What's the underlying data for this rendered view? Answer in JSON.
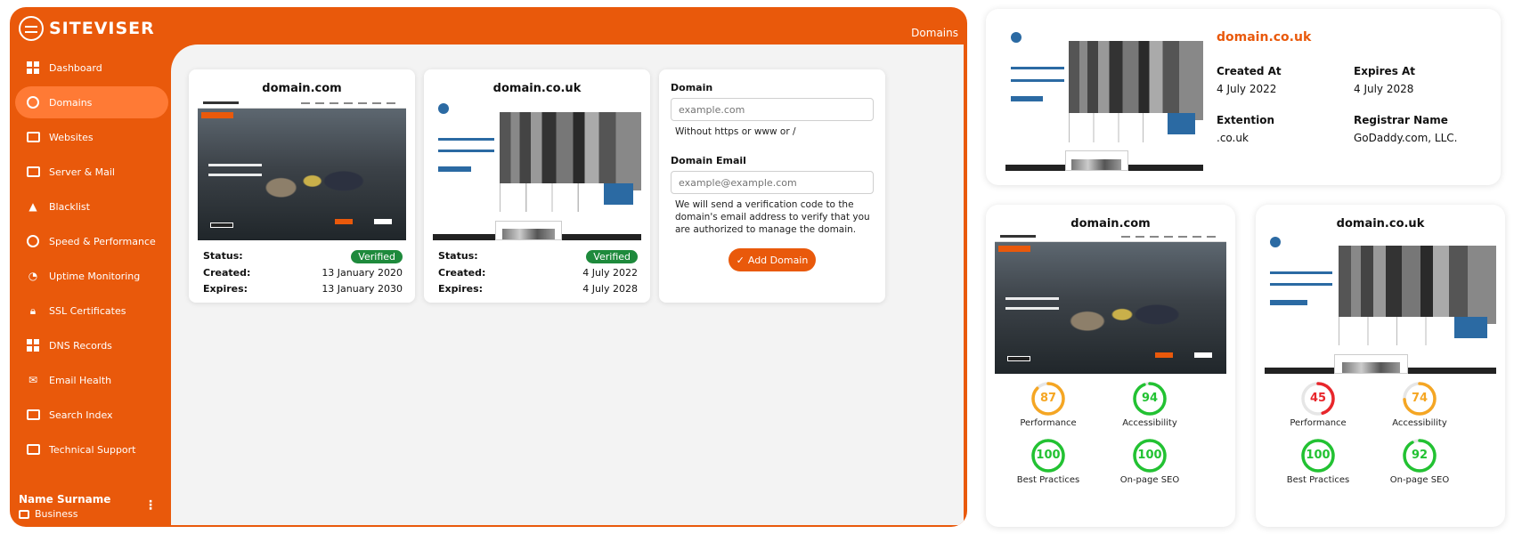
{
  "app": {
    "brand": "SITEVISER",
    "page_title": "Domains"
  },
  "sidebar": {
    "items": [
      {
        "label": "Dashboard",
        "icon": "dashboard-icon"
      },
      {
        "label": "Domains",
        "icon": "globe-icon",
        "active": true
      },
      {
        "label": "Websites",
        "icon": "browser-icon"
      },
      {
        "label": "Server & Mail",
        "icon": "server-icon"
      },
      {
        "label": "Blacklist",
        "icon": "warning-icon"
      },
      {
        "label": "Speed & Performance",
        "icon": "speedometer-icon"
      },
      {
        "label": "Uptime Monitoring",
        "icon": "uptime-icon"
      },
      {
        "label": "SSL Certificates",
        "icon": "lock-icon"
      },
      {
        "label": "DNS Records",
        "icon": "dns-icon"
      },
      {
        "label": "Email Health",
        "icon": "email-icon"
      },
      {
        "label": "Search Index",
        "icon": "search-icon"
      },
      {
        "label": "Technical Support",
        "icon": "support-icon"
      }
    ],
    "user": {
      "name": "Name Surname",
      "plan": "Business"
    }
  },
  "domain_cards": [
    {
      "title": "domain.com",
      "status_label": "Status:",
      "status": "Verified",
      "created_label": "Created:",
      "created": "13 January 2020",
      "expires_label": "Expires:",
      "expires": "13 January 2030"
    },
    {
      "title": "domain.co.uk",
      "status_label": "Status:",
      "status": "Verified",
      "created_label": "Created:",
      "created": "4 July 2022",
      "expires_label": "Expires:",
      "expires": "4 July 2028"
    }
  ],
  "add_form": {
    "domain_label": "Domain",
    "domain_placeholder": "example.com",
    "domain_help": "Without https or www or /",
    "email_label": "Domain Email",
    "email_placeholder": "example@example.com",
    "email_help": "We will send a verification code to the domain's email address to verify that you are authorized to manage the domain.",
    "button_label": "Add Domain"
  },
  "detail_card": {
    "title": "domain.co.uk",
    "created_at_label": "Created At",
    "created_at": "4 July 2022",
    "expires_at_label": "Expires At",
    "expires_at": "4 July 2028",
    "extension_label": "Extention",
    "extension": ".co.uk",
    "registrar_label": "Registrar Name",
    "registrar": "GoDaddy.com, LLC."
  },
  "score_cards": [
    {
      "title": "domain.com",
      "scores": [
        {
          "label": "Performance",
          "value": "87",
          "color": "#f5a623"
        },
        {
          "label": "Accessibility",
          "value": "94",
          "color": "#22c232"
        },
        {
          "label": "Best Practices",
          "value": "100",
          "color": "#22c232"
        },
        {
          "label": "On-page SEO",
          "value": "100",
          "color": "#22c232"
        }
      ]
    },
    {
      "title": "domain.co.uk",
      "scores": [
        {
          "label": "Performance",
          "value": "45",
          "color": "#e8262b"
        },
        {
          "label": "Accessibility",
          "value": "74",
          "color": "#f5a623"
        },
        {
          "label": "Best Practices",
          "value": "100",
          "color": "#22c232"
        },
        {
          "label": "On-page SEO",
          "value": "92",
          "color": "#22c232"
        }
      ]
    }
  ],
  "colors": {
    "brand": "#e9590b",
    "verified": "#1e8a3c"
  }
}
